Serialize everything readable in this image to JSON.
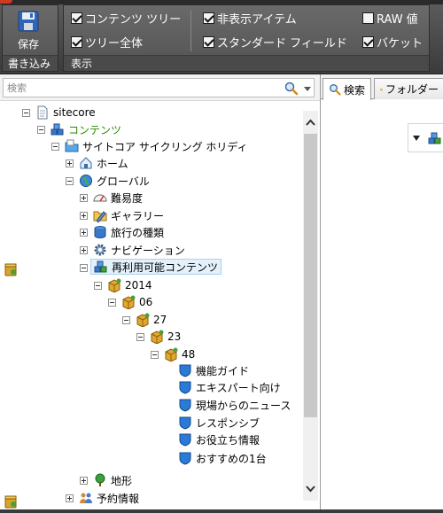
{
  "ribbon": {
    "save_label": "保存",
    "write_group_label": "書き込み",
    "view_group_label": "表示",
    "options": [
      {
        "label": "コンテンツ ツリー",
        "checked": true
      },
      {
        "label": "ツリー全体",
        "checked": true
      },
      {
        "label": "非表示アイテム",
        "checked": true
      },
      {
        "label": "スタンダード フィールド",
        "checked": true
      },
      {
        "label": "RAW 値",
        "checked": false
      },
      {
        "label": "バケット",
        "checked": true
      }
    ]
  },
  "search": {
    "placeholder": "検索"
  },
  "tree": {
    "root": "sitecore",
    "content": "コンテンツ",
    "site": "サイトコア サイクリング ホリディ",
    "home": "ホーム",
    "global": "グローバル",
    "difficulty": "難易度",
    "gallery": "ギャラリー",
    "trip_types": "旅行の種類",
    "navigation": "ナビゲーション",
    "reusable": "再利用可能コンテンツ",
    "y2014": "2014",
    "m06": "06",
    "d27": "27",
    "h23": "23",
    "n48": "48",
    "items": [
      "機能ガイド",
      "エキスパート向け",
      "現場からのニュース",
      "レスポンシブ",
      "お役立ち情報",
      "おすすめの1台"
    ],
    "terrain": "地形",
    "booking": "予約情報"
  },
  "tabs": {
    "search": "検索",
    "folder": "フォルダー"
  }
}
